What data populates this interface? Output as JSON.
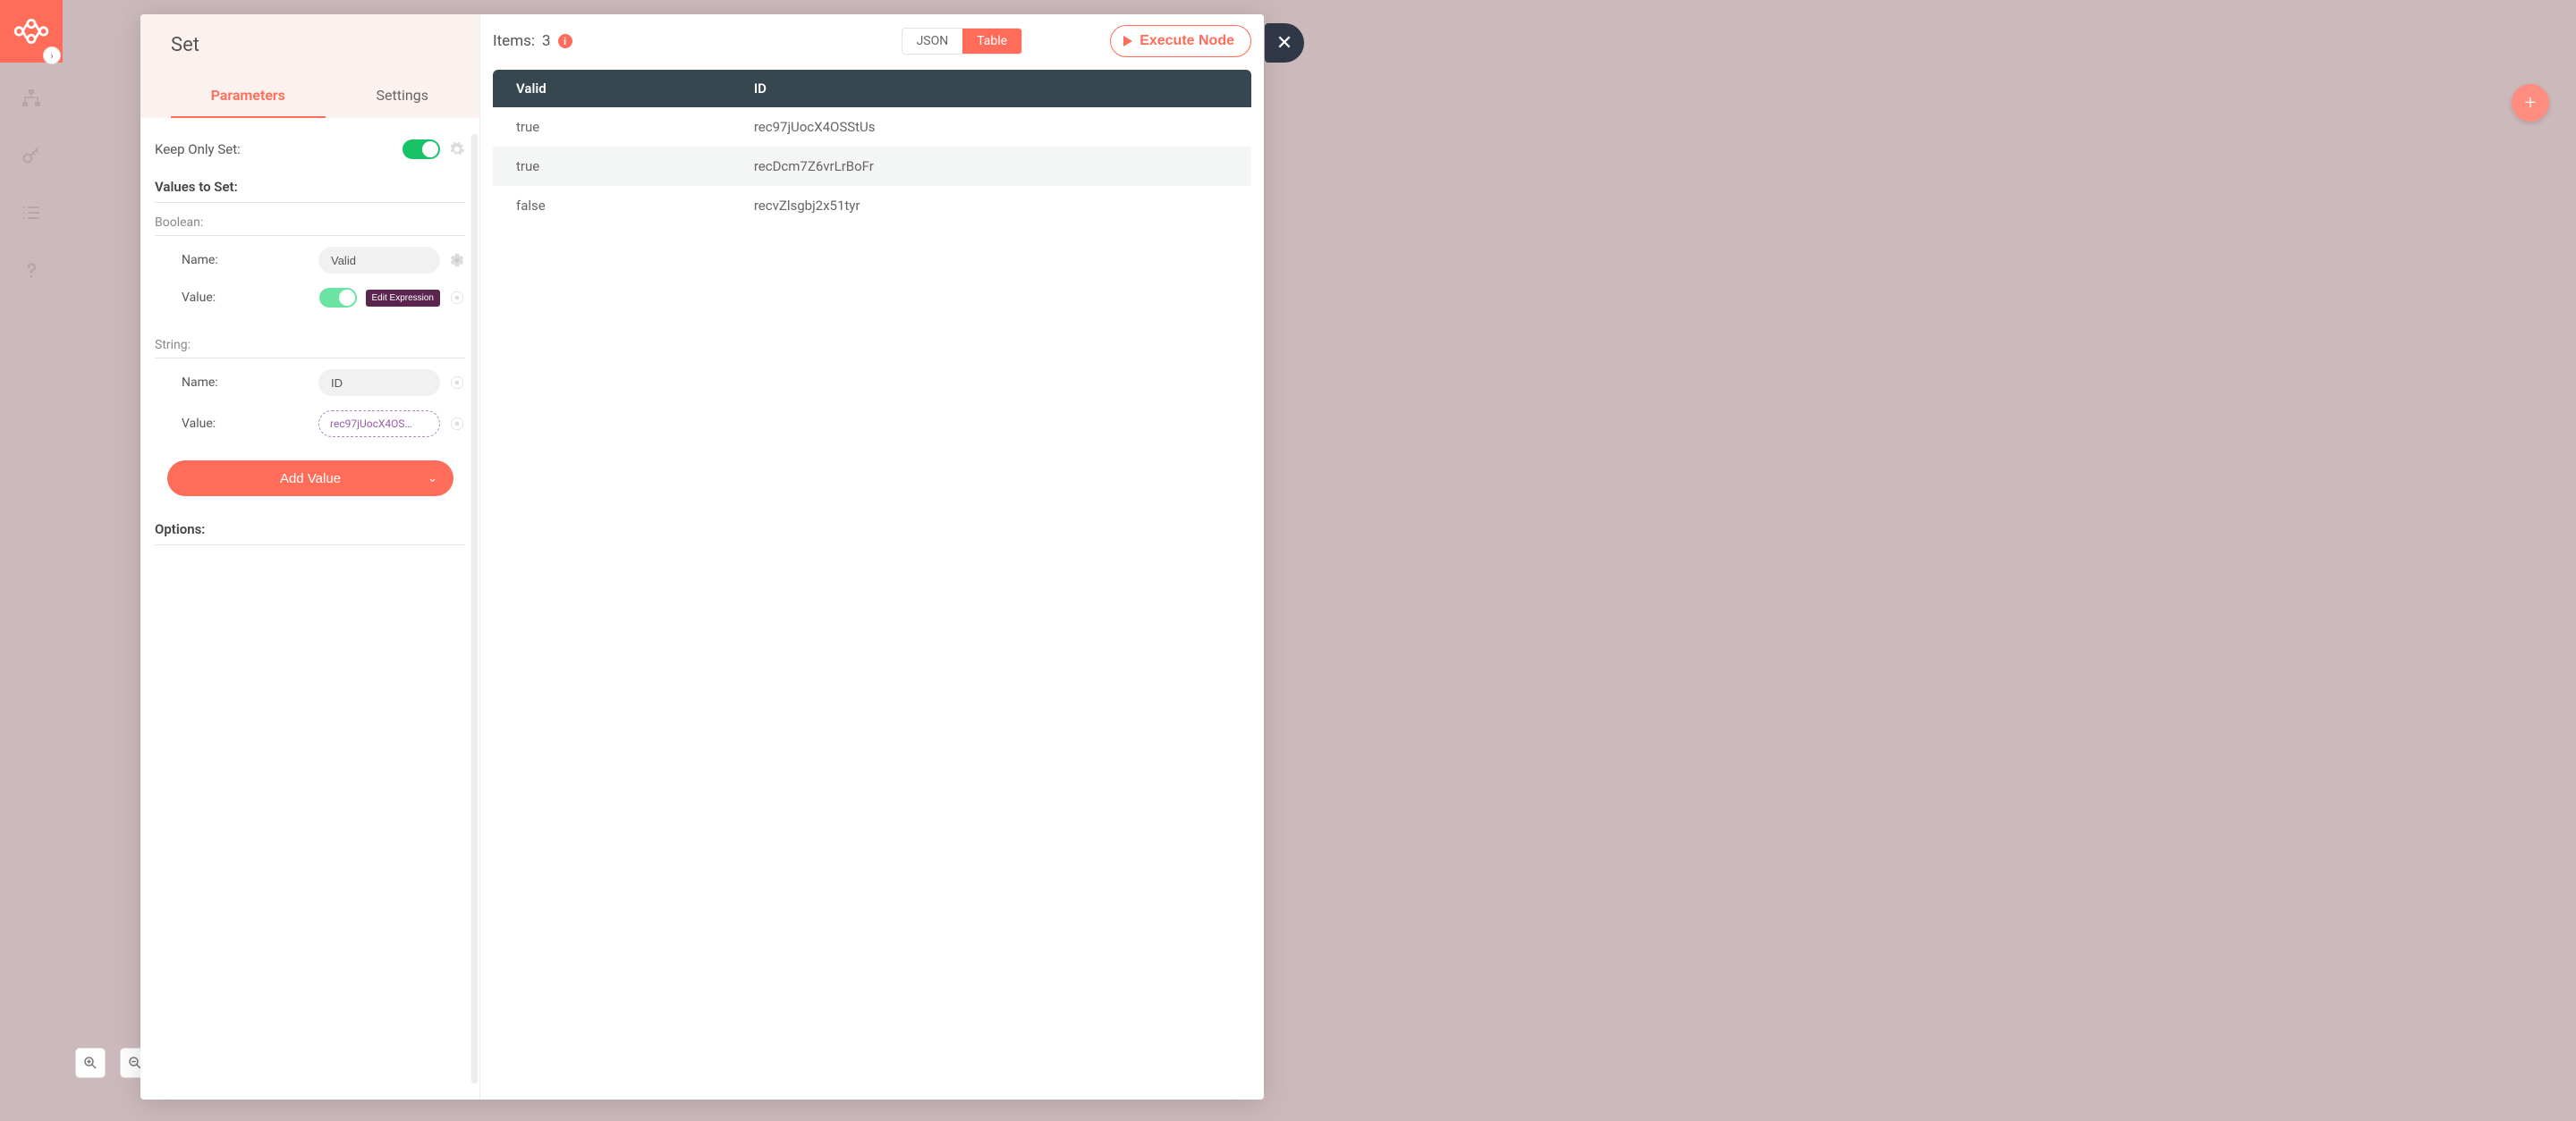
{
  "sidebar": {
    "toggle_glyph": "›"
  },
  "zoom": {
    "in": "+",
    "out": "−"
  },
  "fab": {
    "glyph": "+"
  },
  "close": {
    "glyph": "✕"
  },
  "node": {
    "title": "Set",
    "tabs": {
      "parameters": "Parameters",
      "settings": "Settings"
    }
  },
  "params": {
    "keep_only_set_label": "Keep Only Set:",
    "values_to_set_label": "Values to Set:",
    "boolean_label": "Boolean:",
    "string_label": "String:",
    "name_label": "Name:",
    "value_label": "Value:",
    "bool_name_value": "Valid",
    "edit_expression": "Edit Expression",
    "string_name_value": "ID",
    "string_value_expr": "rec97jUocX4OS…",
    "add_value": "Add Value",
    "add_value_chev": "⌄",
    "options_label": "Options:"
  },
  "output": {
    "items_prefix": "Items:",
    "items_count": "3",
    "info_glyph": "i",
    "view_json": "JSON",
    "view_table": "Table",
    "execute": "Execute Node",
    "columns": [
      "Valid",
      "ID"
    ],
    "rows": [
      {
        "valid": "true",
        "id": "rec97jUocX4OSStUs"
      },
      {
        "valid": "true",
        "id": "recDcm7Z6vrLrBoFr"
      },
      {
        "valid": "false",
        "id": "recvZlsgbj2x51tyr"
      }
    ]
  }
}
